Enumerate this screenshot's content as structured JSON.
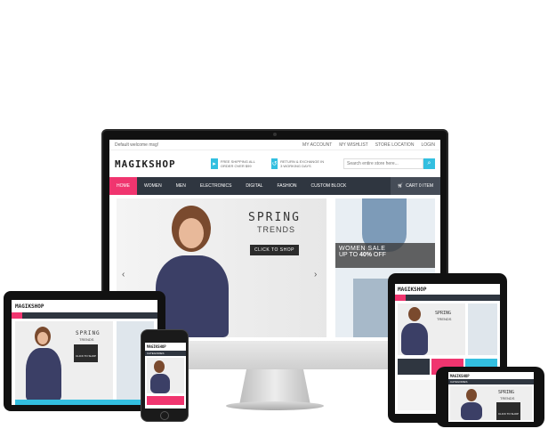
{
  "topbar": {
    "welcome": "Default welcome msg!",
    "links": [
      "MY ACCOUNT",
      "MY WISHLIST",
      "STORE LOCATION",
      "LOGIN"
    ]
  },
  "header": {
    "logo": "MAGIKSHOP",
    "promo1": "FREE SHIPPING ALL ORDER OVER $99",
    "promo2": "RETURN & EXCHANGE IN 3 WORKING DAYS",
    "search_placeholder": "Search entire store here..."
  },
  "nav": {
    "items": [
      "HOME",
      "WOMEN",
      "MEN",
      "ELECTRONICS",
      "DIGITAL",
      "FASHION",
      "CUSTOM BLOCK"
    ],
    "cart": "CART 0 ITEM"
  },
  "hero": {
    "title": "SPRING",
    "subtitle": "TRENDS",
    "button": "CLICK TO SHOP"
  },
  "side_banner": {
    "title": "WOMEN SALE",
    "subtitle_prefix": "UP TO ",
    "percent": "40%",
    "subtitle_suffix": " OFF"
  },
  "mobile": {
    "logo": "MAGIKSHOP",
    "categories": "CATEGORIES",
    "title": "SPRING",
    "subtitle": "TRENDS",
    "button": "CLICK TO SHOP"
  },
  "colors": {
    "accent_pink": "#f0356f",
    "accent_blue": "#33bfe0",
    "nav_dark": "#2f3640"
  }
}
